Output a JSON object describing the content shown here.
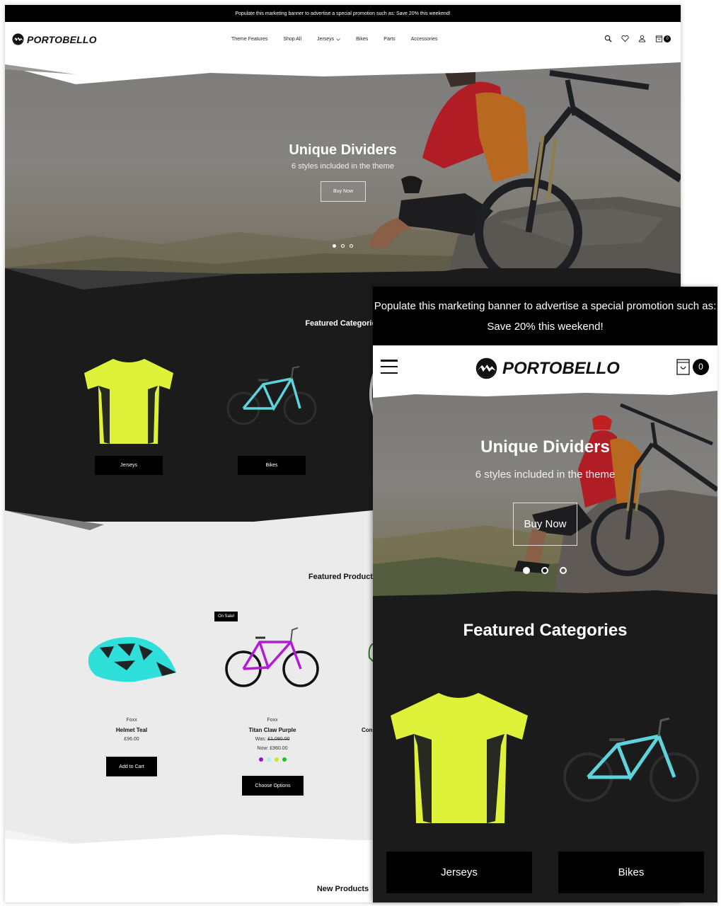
{
  "brand": {
    "name": "PORTOBELLO"
  },
  "desktop": {
    "promo_banner": "Populate this marketing banner to advertise a special promotion such as: Save 20% this weekend!",
    "nav": [
      {
        "label": "Theme Features"
      },
      {
        "label": "Shop All"
      },
      {
        "label": "Jerseys",
        "has_dropdown": true
      },
      {
        "label": "Bikes"
      },
      {
        "label": "Parts"
      },
      {
        "label": "Accessories"
      }
    ],
    "header_icons": [
      "search-icon",
      "heart-icon",
      "user-icon",
      "cart-icon"
    ],
    "cart_count": "0",
    "hero": {
      "title": "Unique Dividers",
      "subtitle": "6 styles included in the theme",
      "button": "Buy Now",
      "slides": 3,
      "active_slide": 1
    },
    "featured_categories": {
      "title": "Featured Categories",
      "items": [
        {
          "label": "Jerseys"
        },
        {
          "label": "Bikes"
        }
      ]
    },
    "featured_products": {
      "title": "Featured Products",
      "items": [
        {
          "brand": "Foxx",
          "name": "Helmet Teal",
          "price": "£96.00",
          "button": "Add to Cart"
        },
        {
          "badge": "On Sale!",
          "brand": "Foxx",
          "name": "Titan Claw Purple",
          "was_label": "Was:",
          "was_price": "£1,080.00",
          "now_label": "Now: £960.00",
          "swatches": [
            "#9b12c9",
            "#a9eef2",
            "#c5ef1b",
            "#1bc41e"
          ],
          "button": "Choose Options"
        },
        {
          "name_partial": "Con"
        }
      ]
    },
    "new_products": {
      "title": "New Products"
    }
  },
  "mobile": {
    "promo_banner": "Populate this marketing banner to advertise a special promotion such as: Save 20% this weekend!",
    "cart_count": "0",
    "hero": {
      "title": "Unique Dividers",
      "subtitle": "6 styles included in the theme",
      "button": "Buy Now",
      "slides": 3,
      "active_slide": 1
    },
    "featured_categories": {
      "title": "Featured Categories",
      "items": [
        {
          "label": "Jerseys"
        },
        {
          "label": "Bikes"
        }
      ]
    }
  },
  "colors": {
    "banner_bg": "#000000",
    "dark_section": "#1b1b1b",
    "light_section": "#ebebeb",
    "jersey_yellow": "#dff23a",
    "bike_teal": "#5ed3dc",
    "helmet_teal": "#2fe0da",
    "bike_purple": "#b21ad6"
  }
}
